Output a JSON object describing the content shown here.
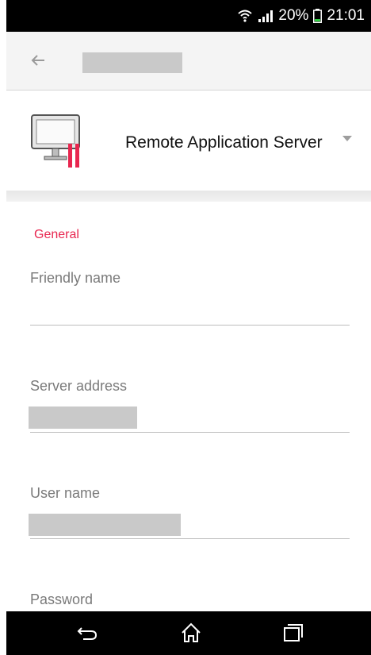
{
  "status_bar": {
    "battery_percent": "20%",
    "time": "21:01"
  },
  "app_bar": {
    "back_icon": "arrow-back-icon"
  },
  "connection_type": {
    "label": "Remote Application Server",
    "icon": "server-monitor-icon"
  },
  "form": {
    "section_title": "General",
    "fields": [
      {
        "label": "Friendly name",
        "value": ""
      },
      {
        "label": "Server address",
        "value": ""
      },
      {
        "label": "User name",
        "value": ""
      },
      {
        "label": "Password",
        "value": ""
      }
    ]
  },
  "nav_bar": {
    "buttons": [
      "back-icon",
      "home-icon",
      "recents-icon"
    ]
  },
  "colors": {
    "accent": "#e8264f",
    "status_bg": "#000000",
    "app_bar_bg": "#f4f4f4"
  }
}
